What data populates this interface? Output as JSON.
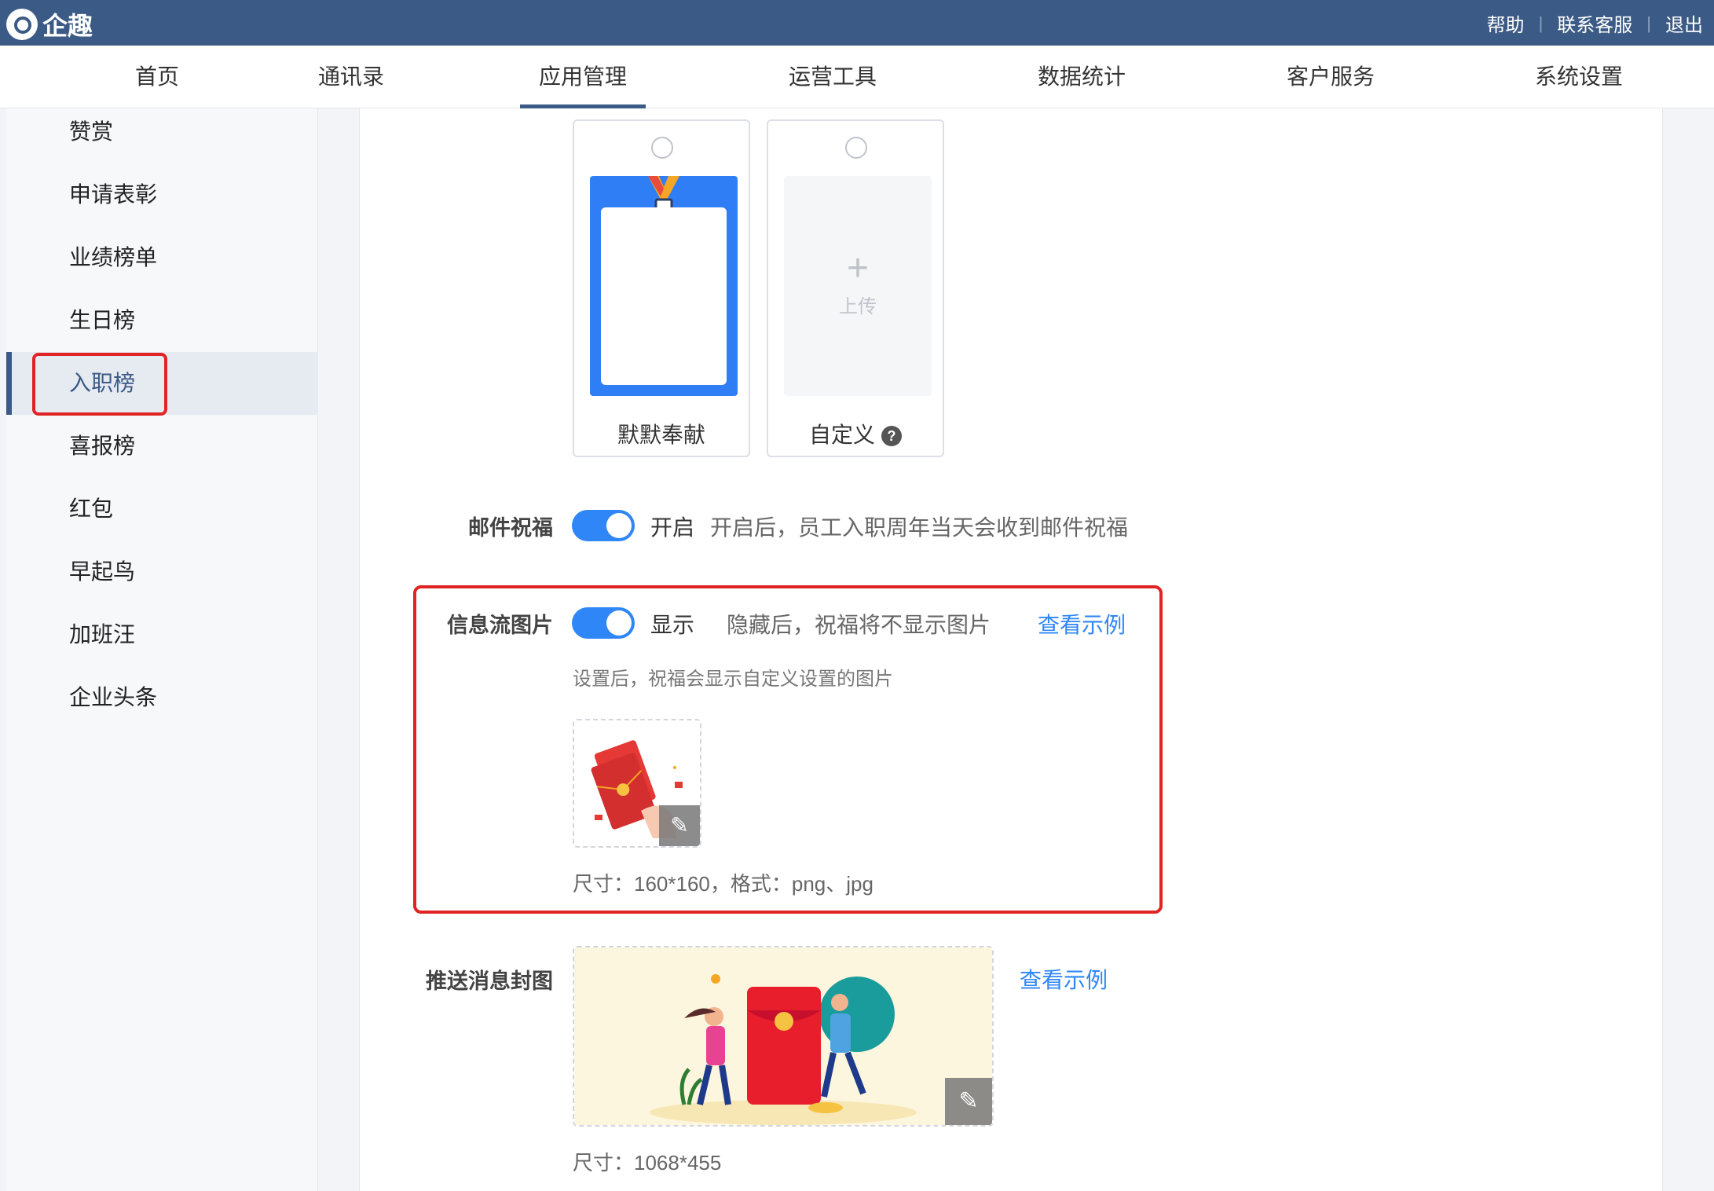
{
  "app": {
    "name": "企趣"
  },
  "top_links": [
    "帮助",
    "联系客服",
    "退出"
  ],
  "nav": [
    "首页",
    "通讯录",
    "应用管理",
    "运营工具",
    "数据统计",
    "客户服务",
    "系统设置"
  ],
  "nav_active": "应用管理",
  "sidebar": [
    "赞赏",
    "申请表彰",
    "业绩榜单",
    "生日榜",
    "入职榜",
    "喜报榜",
    "红包",
    "早起鸟",
    "加班汪",
    "企业头条"
  ],
  "sidebar_active": "入职榜",
  "templates": [
    {
      "label": "默默奉献"
    },
    {
      "label": "自定义",
      "upload_label": "上传",
      "help_icon": "question-circle-icon"
    }
  ],
  "email": {
    "label": "邮件祝福",
    "state": "开启",
    "desc": "开启后，员工入职周年当天会收到邮件祝福",
    "enabled": true
  },
  "feed_image": {
    "label": "信息流图片",
    "state": "显示",
    "desc": "隐藏后，祝福将不显示图片",
    "link": "查看示例",
    "hint": "设置后，祝福会显示自定义设置的图片",
    "size_note": "尺寸：160*160，格式：png、jpg",
    "enabled": true
  },
  "push_cover": {
    "label": "推送消息封图",
    "link": "查看示例",
    "size_note": "尺寸：1068*455"
  },
  "colors": {
    "header": "#3b5a85",
    "accent": "#2f86f6",
    "highlight": "#e02424"
  }
}
